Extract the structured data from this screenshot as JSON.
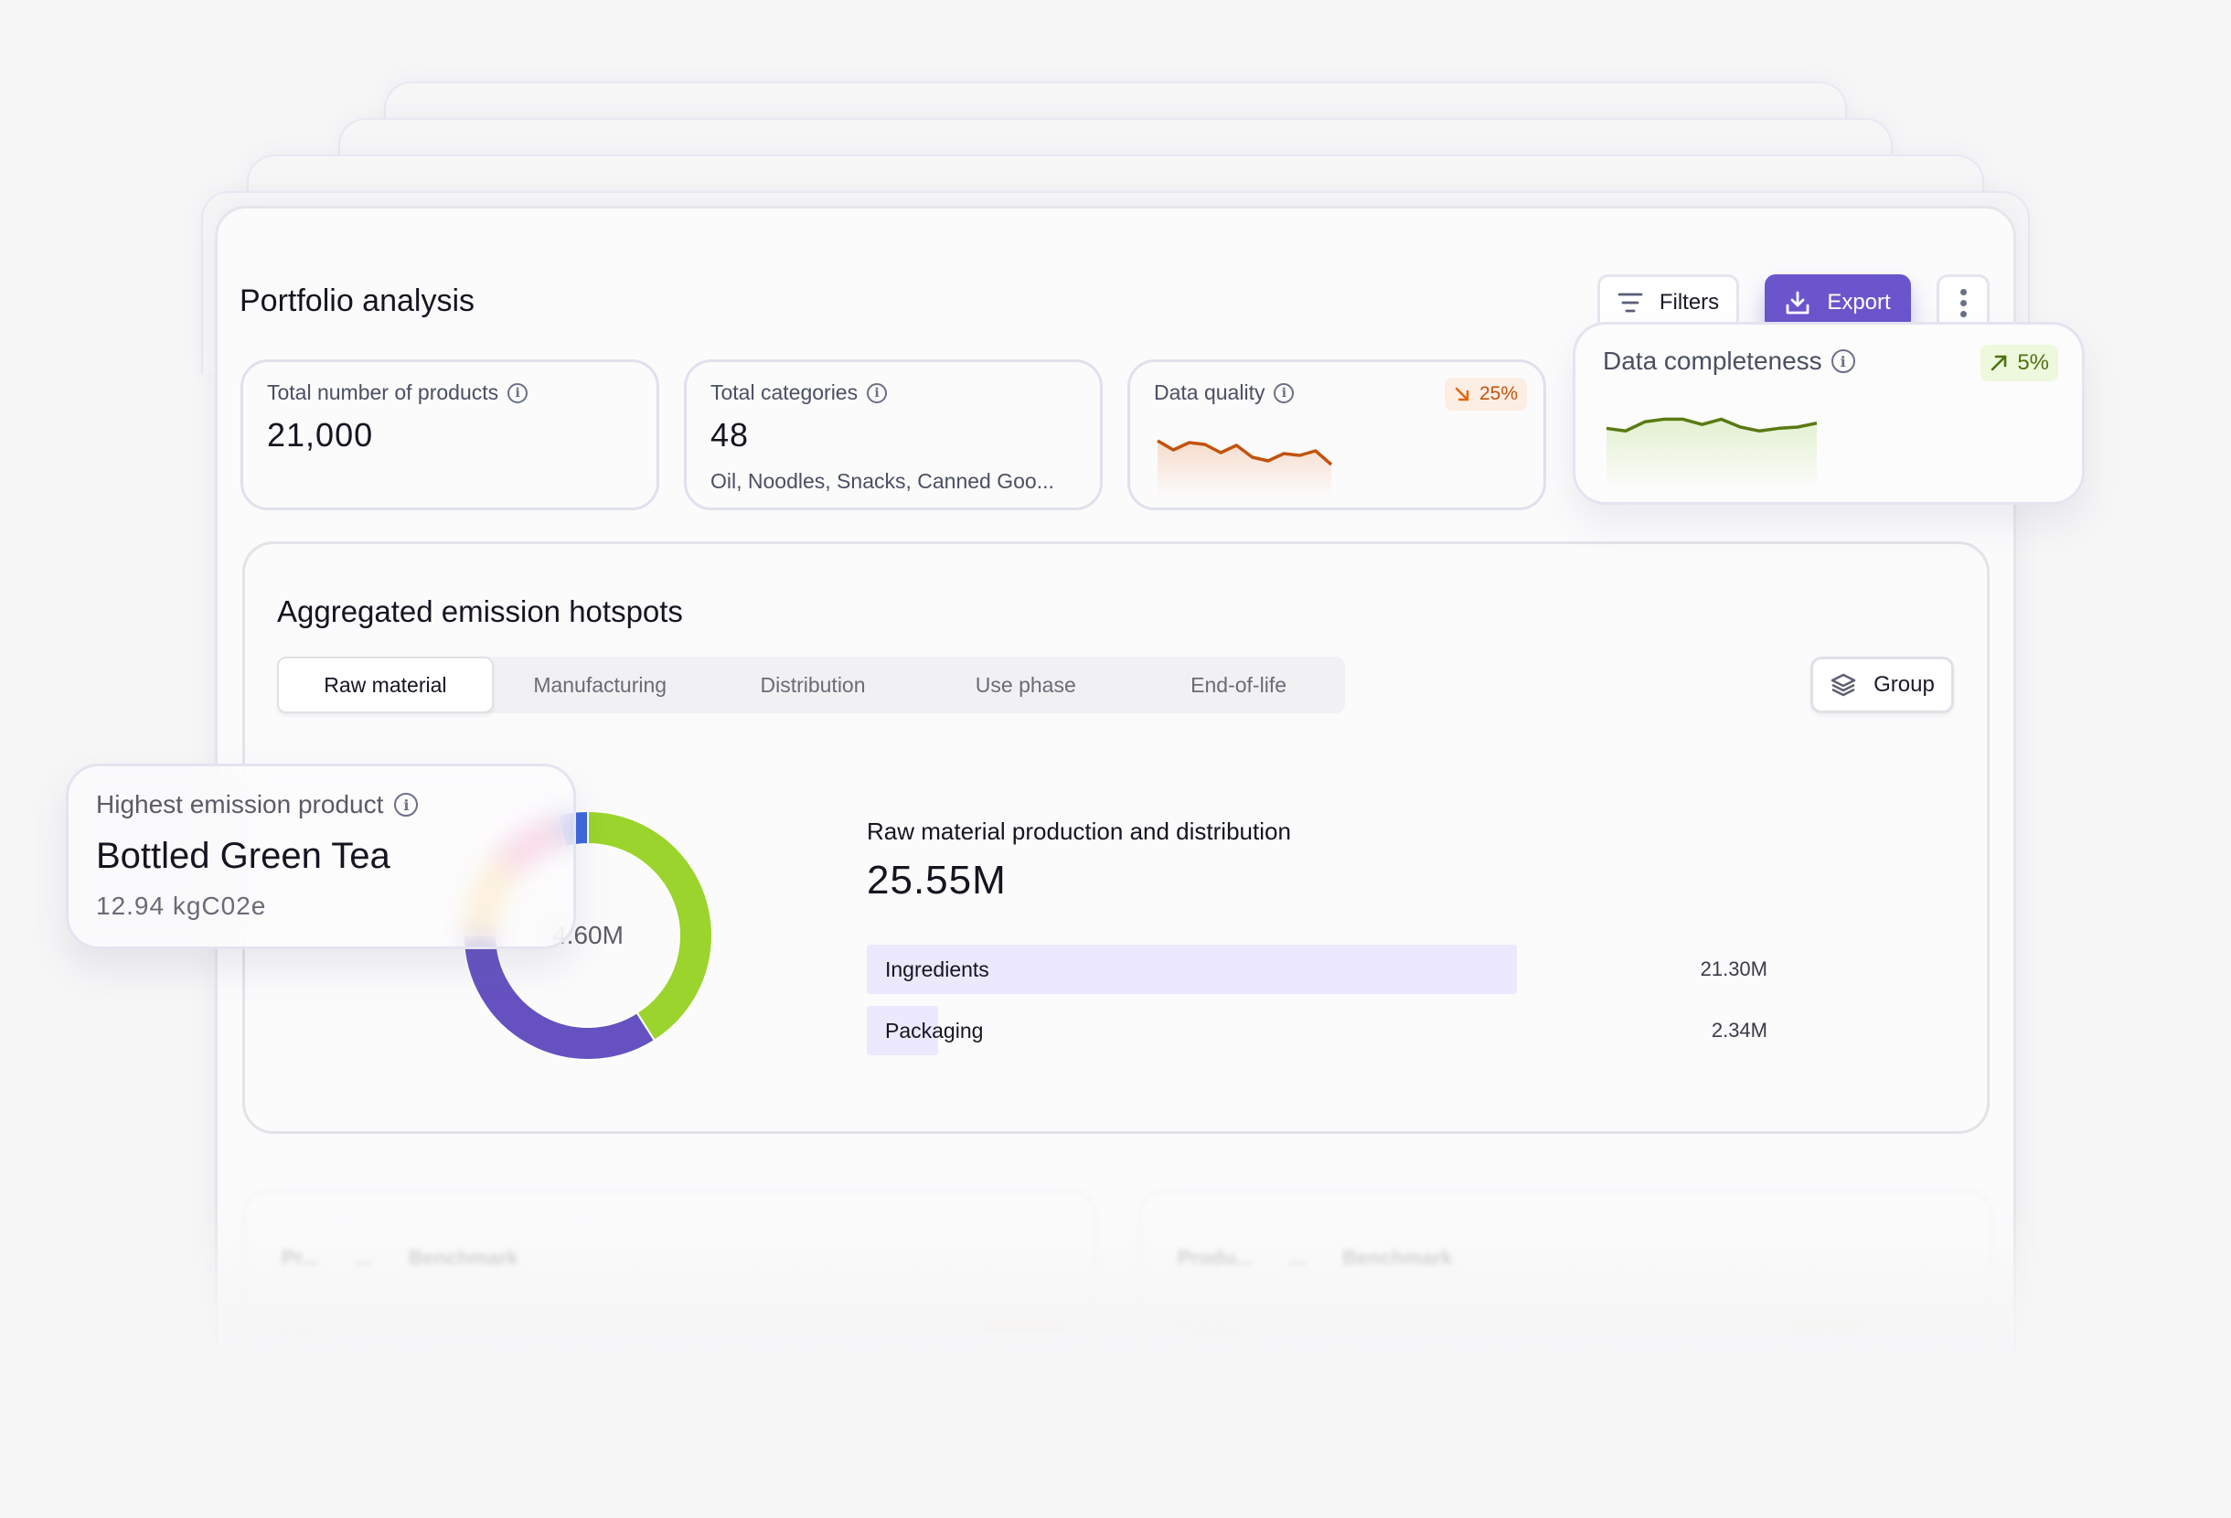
{
  "page": {
    "title": "Portfolio analysis",
    "filters_label": "Filters",
    "export_label": "Export",
    "more_icon": "kebab-vertical-icon"
  },
  "stats": [
    {
      "label": "Total number of products",
      "value": "21,000"
    },
    {
      "label": "Total categories",
      "value": "48",
      "sub": "Oil, Noodles, Snacks, Canned Goo..."
    },
    {
      "label": "Data quality",
      "badge": "25%",
      "trend": "down",
      "sparkline": [
        62,
        52,
        60,
        58,
        49,
        57,
        44,
        40,
        48,
        46,
        51,
        36
      ]
    }
  ],
  "data_completeness": {
    "label": "Data completeness",
    "badge": "5%",
    "trend": "up",
    "sparkline": [
      48,
      46,
      53,
      55,
      55,
      51,
      55,
      49,
      46,
      48,
      49,
      52
    ]
  },
  "hotspots": {
    "title": "Aggregated emission hotspots",
    "tabs": [
      {
        "label": "Raw material",
        "active": true
      },
      {
        "label": "Manufacturing",
        "active": false
      },
      {
        "label": "Distribution",
        "active": false
      },
      {
        "label": "Use phase",
        "active": false
      },
      {
        "label": "End-of-life",
        "active": false
      }
    ],
    "group_label": "Group",
    "donut_center": "4.60M",
    "breakdown_title": "Raw material production and distribution",
    "breakdown_total": "25.55M",
    "bars": [
      {
        "label": "Ingredients",
        "value": "21.30M",
        "amount": 21.3
      },
      {
        "label": "Packaging",
        "value": "2.34M",
        "amount": 2.34
      }
    ]
  },
  "chart_data": {
    "type": "pie",
    "title": "",
    "center_label": "4.60M",
    "series": [
      {
        "name": "green",
        "value": 41,
        "color": "#9ad42c"
      },
      {
        "name": "purple",
        "value": 34,
        "color": "#6552c0"
      },
      {
        "name": "yellow",
        "value": 11,
        "color": "#fdd07a"
      },
      {
        "name": "pink",
        "value": 10,
        "color": "#ef85ae"
      },
      {
        "name": "blue",
        "value": 4,
        "color": "#3d66dc"
      }
    ]
  },
  "highlight": {
    "label": "Highest emission product",
    "name": "Bottled Green Tea",
    "value": "12.94 kgC02e"
  },
  "tables": [
    {
      "headers": [
        "Pr...",
        "...",
        "Benchmark"
      ],
      "row": "Kim...",
      "bar_color": "#f7c9ad"
    },
    {
      "headers": [
        "Produ...",
        "...",
        "Benchmark"
      ],
      "row": "Paleiko...",
      "bar_color": "#dcefc2"
    }
  ],
  "colors": {
    "accent": "#6b55cc",
    "down": "#c2530d",
    "up": "#4d7310"
  }
}
